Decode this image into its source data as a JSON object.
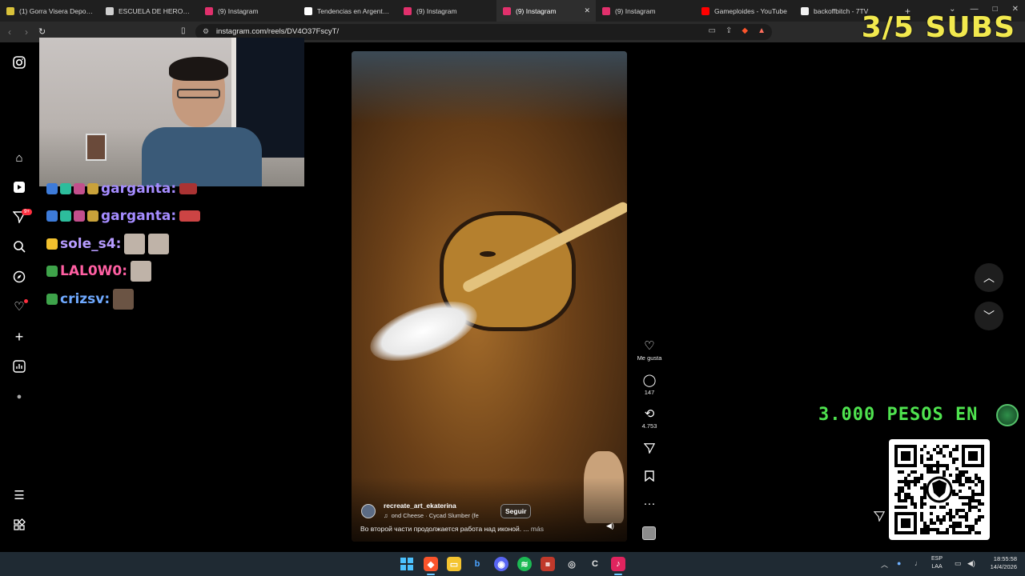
{
  "browser": {
    "tabs": [
      {
        "title": "(1) Gorra Visera Deportiv",
        "favicon_color": "#d9c23a"
      },
      {
        "title": "ESCUELA DE HEROES ELE",
        "favicon_color": "#cfcfcf"
      },
      {
        "title": "(9) Instagram",
        "favicon_color": "#e1306c"
      },
      {
        "title": "Tendencias en Argentina",
        "favicon_color": "#ffffff"
      },
      {
        "title": "(9) Instagram",
        "favicon_color": "#e1306c"
      },
      {
        "title": "(9) Instagram",
        "favicon_color": "#e1306c",
        "active": true
      },
      {
        "title": "(9) Instagram",
        "favicon_color": "#e1306c"
      },
      {
        "title": "Gameploides - YouTube",
        "favicon_color": "#ff0000"
      },
      {
        "title": "backoffbitch - 7TV",
        "favicon_color": "#f2f2f2"
      }
    ],
    "url": "instagram.com/reels/DV4O37FscyT/"
  },
  "overlay": {
    "subs_text": "3/5 SUBS",
    "pesos_text": "3.000 PESOS EN"
  },
  "sidebar": {
    "notification_badge": "9+",
    "icons": [
      "instagram-logo-icon",
      "home-icon",
      "reels-icon",
      "messages-icon",
      "search-icon",
      "explore-icon",
      "notifications-icon",
      "create-icon",
      "dashboard-icon",
      "profile-icon",
      "menu-icon",
      "more-apps-icon"
    ]
  },
  "chat": {
    "messages": [
      {
        "user": "garganta:",
        "color": "#a58cff"
      },
      {
        "user": "garganta:",
        "color": "#a58cff"
      },
      {
        "user": "sole_s4:",
        "color": "#b69bff"
      },
      {
        "user": "LAL0W0:",
        "color": "#ff5fa2"
      },
      {
        "user": "crizsv:",
        "color": "#6fa9ff"
      }
    ]
  },
  "reel": {
    "username": "recreate_art_ekaterina",
    "music": "ond Cheese · Cycad Slumber (fe",
    "follow_label": "Seguir",
    "caption": "Во второй части продолжается работа над иконой. ...",
    "more_label": "más"
  },
  "actions": {
    "like_label": "Me gusta",
    "comments": "147",
    "reposts": "4.753"
  },
  "taskbar": {
    "lang_line1": "ESP",
    "lang_line2": "LAA",
    "time": "18:55:58",
    "date": "14/4/2026"
  }
}
